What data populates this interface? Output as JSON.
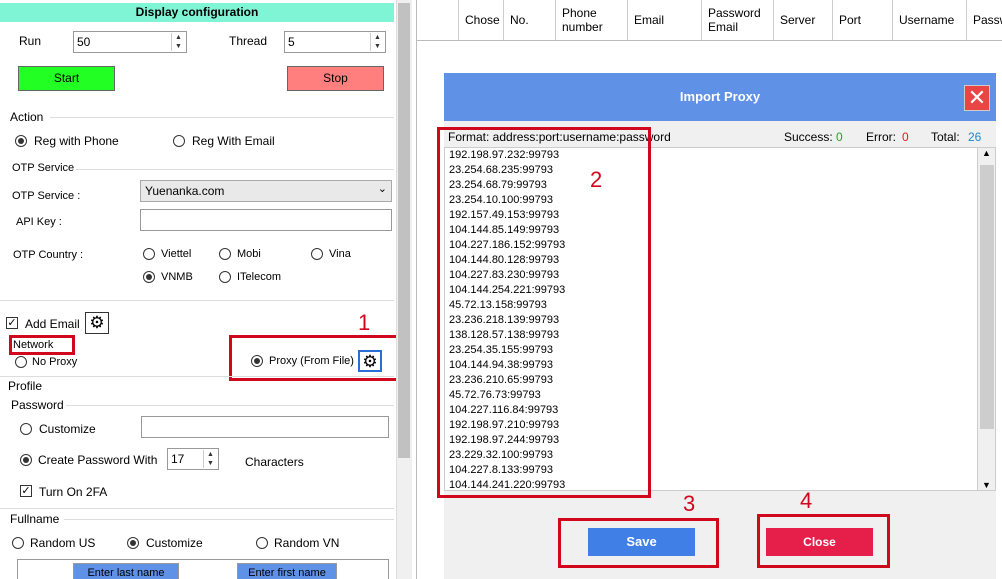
{
  "left_panel": {
    "title": "Display configuration",
    "run_label": "Run",
    "run_value": "50",
    "thread_label": "Thread",
    "thread_value": "5",
    "start_label": "Start",
    "stop_label": "Stop",
    "action_header": "Action",
    "reg_phone": "Reg with Phone",
    "reg_email": "Reg With Email",
    "otp_header": "OTP Service",
    "otp_service_label": "OTP Service :",
    "otp_service_value": "Yuenanka.com",
    "api_key_label": "API Key :",
    "api_key_value": "",
    "otp_country_label": "OTP Country :",
    "countries": [
      "Viettel",
      "Mobi",
      "Vina",
      "VNMB",
      "ITelecom"
    ],
    "add_email": "Add Email",
    "network_label": "Network",
    "no_proxy": "No Proxy",
    "proxy_file": "Proxy (From File)",
    "profile_header": "Profile",
    "password_header": "Password",
    "customize_label": "Customize",
    "create_password": "Create Password With",
    "password_length": "17",
    "characters": "Characters",
    "turn_on_2fa": "Turn On 2FA",
    "fullname_header": "Fullname",
    "random_us": "Random US",
    "customize_name": "Customize",
    "random_vn": "Random VN",
    "enter_last_name": "Enter last name",
    "enter_first_name": "Enter first name"
  },
  "table": {
    "headers": [
      "",
      "Chose",
      "No.",
      "Phone number",
      "Email",
      "Password Email",
      "Server",
      "Port",
      "Username",
      "Passw"
    ]
  },
  "dialog": {
    "title": "Import Proxy",
    "format": "Format: address:port:username:password",
    "success_label": "Success:",
    "success_value": "0",
    "error_label": "Error:",
    "error_value": "0",
    "total_label": "Total:",
    "total_value": "26",
    "proxies": [
      "192.198.97.232:99793",
      "23.254.68.235:99793",
      "23.254.68.79:99793",
      "23.254.10.100:99793",
      "192.157.49.153:99793",
      "104.144.85.149:99793",
      "104.227.186.152:99793",
      "104.144.80.128:99793",
      "104.227.83.230:99793",
      "104.144.254.221:99793",
      "45.72.13.158:99793",
      "23.236.218.139:99793",
      "138.128.57.138:99793",
      "23.254.35.155:99793",
      "104.144.94.38:99793",
      "23.236.210.65:99793",
      "45.72.76.73:99793",
      "104.227.116.84:99793",
      "192.198.97.210:99793",
      "192.198.97.244:99793",
      "23.229.32.100:99793",
      "104.227.8.133:99793",
      "104.144.241.220:99793"
    ],
    "save_label": "Save",
    "close_label": "Close"
  },
  "annotations": [
    "1",
    "2",
    "3",
    "4"
  ],
  "colors": {
    "title_bar": "#7ff5d5",
    "start": "#22ff22",
    "stop": "#ff7f7f",
    "dialog_header": "#5f91e6",
    "save": "#3f7fe6",
    "close": "#e61e4a",
    "annotation": "#d0081d"
  }
}
